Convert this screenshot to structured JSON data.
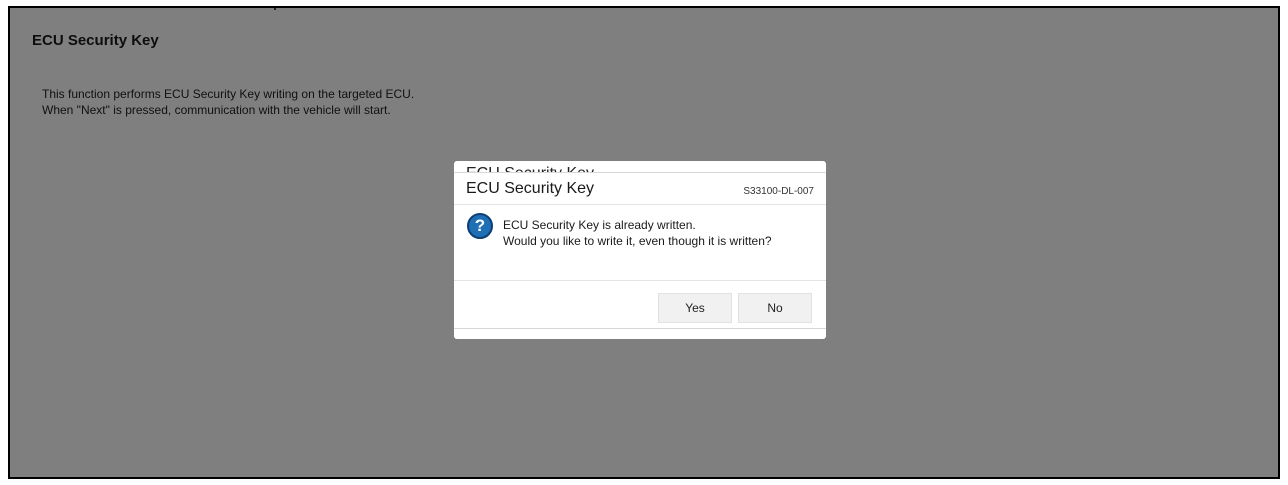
{
  "page": {
    "title": "ECU Security Key",
    "description_lines": [
      "This function performs ECU Security Key writing on the targeted ECU.",
      "When \"Next\" is pressed, communication with the vehicle will start."
    ]
  },
  "back_dialog": {
    "title": "ECU Security Key"
  },
  "dialog": {
    "title": "ECU Security Key",
    "code": "S33100-DL-007",
    "icon": "question-icon",
    "message_lines": [
      "ECU Security Key is already written.",
      "Would you like to write it, even though it is written?"
    ],
    "yes_label": "Yes",
    "no_label": "No"
  },
  "colors": {
    "overlay": "#808080",
    "icon_blue": "#1f6fb5",
    "button_bg": "#f1f1f1"
  }
}
